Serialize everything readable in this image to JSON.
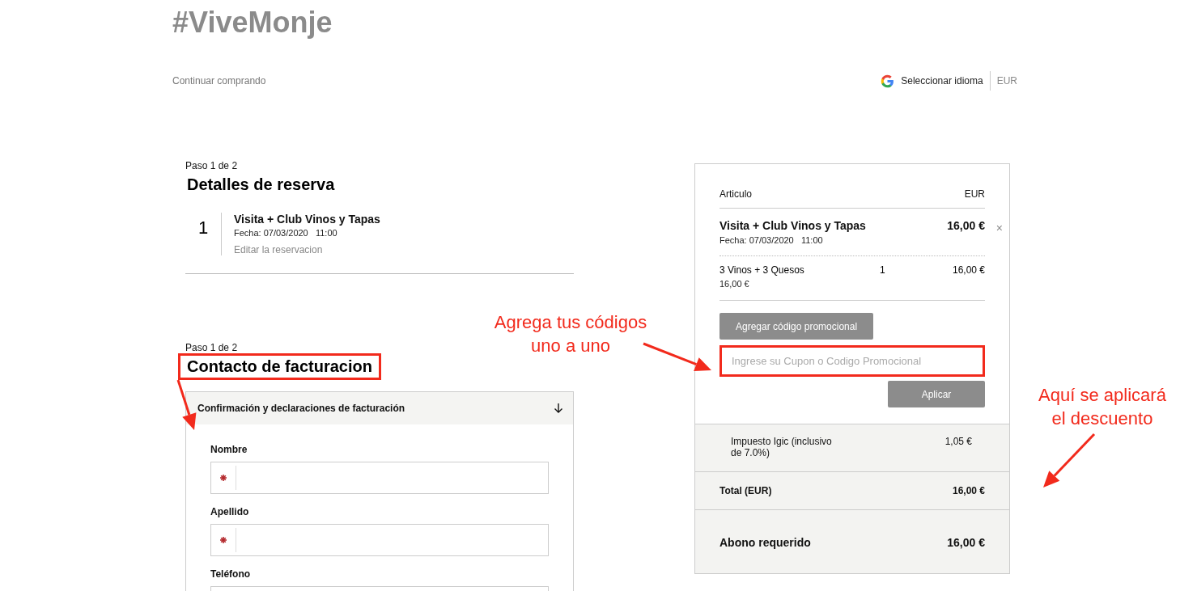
{
  "brand": "#ViveMonje",
  "nav": {
    "continue_link": "Continuar comprando",
    "language": "Seleccionar idioma",
    "currency": "EUR"
  },
  "booking": {
    "step": "Paso 1 de 2",
    "title": "Detalles de reserva",
    "items": [
      {
        "number": "1",
        "name": "Visita + Club Vinos y Tapas",
        "date": "Fecha: 07/03/2020",
        "time": "11:00",
        "edit_link": "Editar la reservacion"
      }
    ]
  },
  "billing": {
    "step": "Paso 1 de 2",
    "title": "Contacto de facturacion",
    "highlighted": true,
    "section": {
      "title": "Confirmación y declaraciones de facturación",
      "expanded": true
    },
    "fields": [
      {
        "label": "Nombre",
        "required": true
      },
      {
        "label": "Apellido",
        "required": true
      },
      {
        "label": "Teléfono",
        "required": false
      }
    ]
  },
  "cart": {
    "column_item": "Articulo",
    "column_currency": "EUR",
    "item": {
      "name": "Visita + Club Vinos y Tapas",
      "price": "16,00 €",
      "date": "Fecha: 07/03/2020",
      "time": "11:00",
      "remove": "×"
    },
    "lines": [
      {
        "name": "3 Vinos + 3 Quesos",
        "unit_price": "16,00 €",
        "quantity": "1",
        "total": "16,00 €"
      }
    ],
    "promo_button": "Agregar código promocional",
    "promo_field": {
      "placeholder": "Ingrese su Cupon o Codigo Promocional",
      "highlighted": true
    },
    "apply_button": "Aplicar",
    "tax": {
      "label": "Impuesto Igic (inclusivo de 7.0%)",
      "value": "1,05 €"
    },
    "total": {
      "label": "Total (EUR)",
      "value": "16,00 €"
    },
    "deposit": {
      "label": "Abono requerido",
      "value": "16,00 €"
    }
  },
  "annotations": [
    {
      "text": "Agrega tus códigos uno a uno",
      "kind": "promo"
    },
    {
      "text": "Aquí se aplicará el descuento",
      "kind": "discount"
    }
  ]
}
